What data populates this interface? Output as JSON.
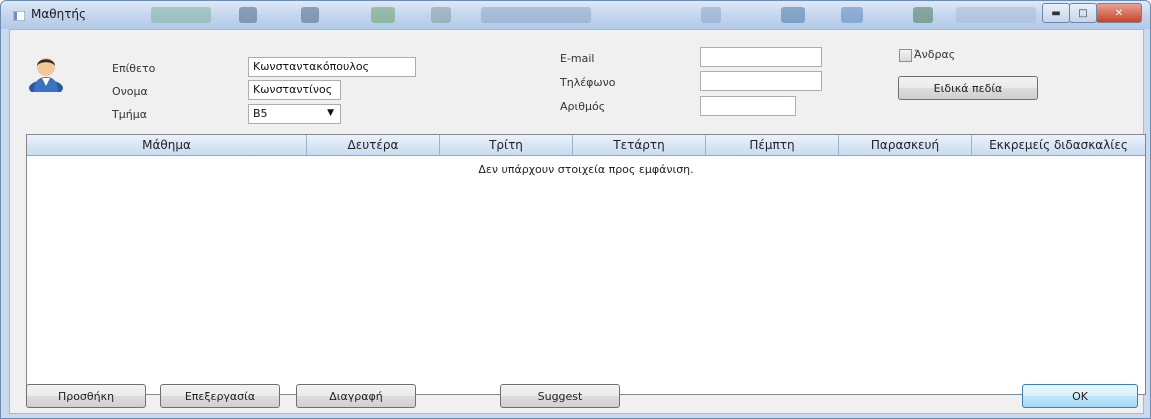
{
  "window": {
    "title": "Μαθητής"
  },
  "form": {
    "surname_label": "Επίθετο",
    "surname_value": "Κωνσταντακόπουλος",
    "name_label": "Ονομα",
    "name_value": "Κωνσταντίνος",
    "class_label": "Τμήμα",
    "class_value": "B5",
    "email_label": "E-mail",
    "email_value": "",
    "phone_label": "Τηλέφωνο",
    "phone_value": "",
    "number_label": "Αριθμός",
    "number_value": "",
    "male_label": "Άνδρας",
    "male_checked": false,
    "special_fields_label": "Ειδικά πεδία"
  },
  "grid": {
    "columns": [
      "Μάθημα",
      "Δευτέρα",
      "Τρίτη",
      "Τετάρτη",
      "Πέμπτη",
      "Παρασκευή",
      "Εκκρεμείς διδασκαλίες"
    ],
    "empty_text": "Δεν υπάρχουν στοιχεία προς εμφάνιση."
  },
  "buttons": {
    "add": "Προσθήκη",
    "edit": "Επεξεργασία",
    "delete": "Διαγραφή",
    "suggest": "Suggest",
    "ok": "OK"
  },
  "icons": {
    "avatar": "student-avatar-icon",
    "window": "window-icon"
  }
}
